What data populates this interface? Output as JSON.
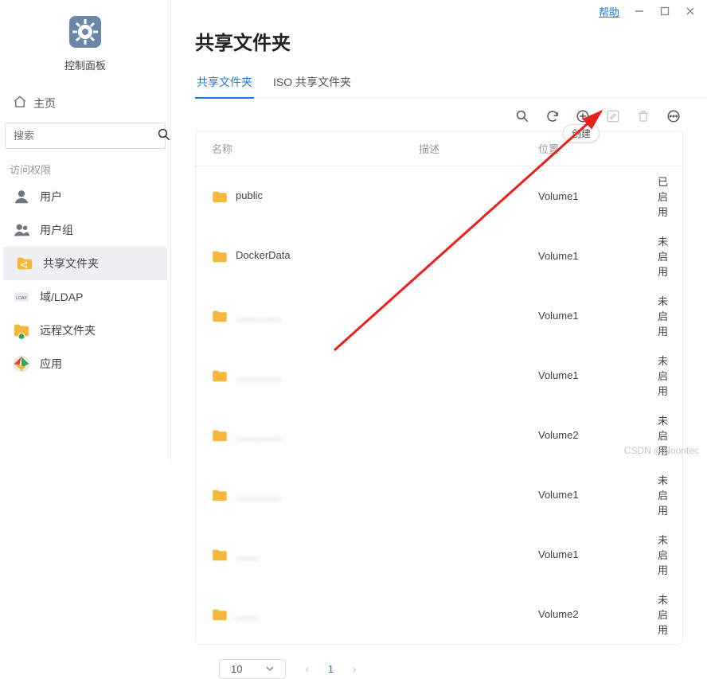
{
  "titlebar": {
    "help": "帮助"
  },
  "sidebar": {
    "app_title": "控制面板",
    "home": "主页",
    "search_placeholder": "搜索",
    "section": "访问权限",
    "items": [
      {
        "label": "用户"
      },
      {
        "label": "用户组"
      },
      {
        "label": "共享文件夹"
      },
      {
        "label": "域/LDAP"
      },
      {
        "label": "远程文件夹"
      },
      {
        "label": "应用"
      }
    ]
  },
  "main": {
    "title": "共享文件夹",
    "tabs": [
      {
        "label": "共享文件夹",
        "active": true
      },
      {
        "label": "ISO 共享文件夹",
        "active": false
      }
    ],
    "tooltip_create": "创建",
    "columns": {
      "name": "名称",
      "desc": "描述",
      "loc": "位置",
      "status": ""
    },
    "rows": [
      {
        "name": "public",
        "loc": "Volume1",
        "status": "已启用",
        "blur": false
      },
      {
        "name": "DockerData",
        "loc": "Volume1",
        "status": "未启用",
        "blur": false
      },
      {
        "name": "________",
        "loc": "Volume1",
        "status": "未启用",
        "blur": true
      },
      {
        "name": "________",
        "loc": "Volume1",
        "status": "未启用",
        "blur": true
      },
      {
        "name": "________",
        "loc": "Volume2",
        "status": "未启用",
        "blur": true
      },
      {
        "name": "________",
        "loc": "Volume1",
        "status": "未启用",
        "blur": true
      },
      {
        "name": "____",
        "loc": "Volume1",
        "status": "未启用",
        "blur": true
      },
      {
        "name": "____",
        "loc": "Volume2",
        "status": "未启用",
        "blur": true
      }
    ],
    "pager": {
      "size": "10",
      "page": "1"
    }
  },
  "watermark": "CSDN @Noontec"
}
